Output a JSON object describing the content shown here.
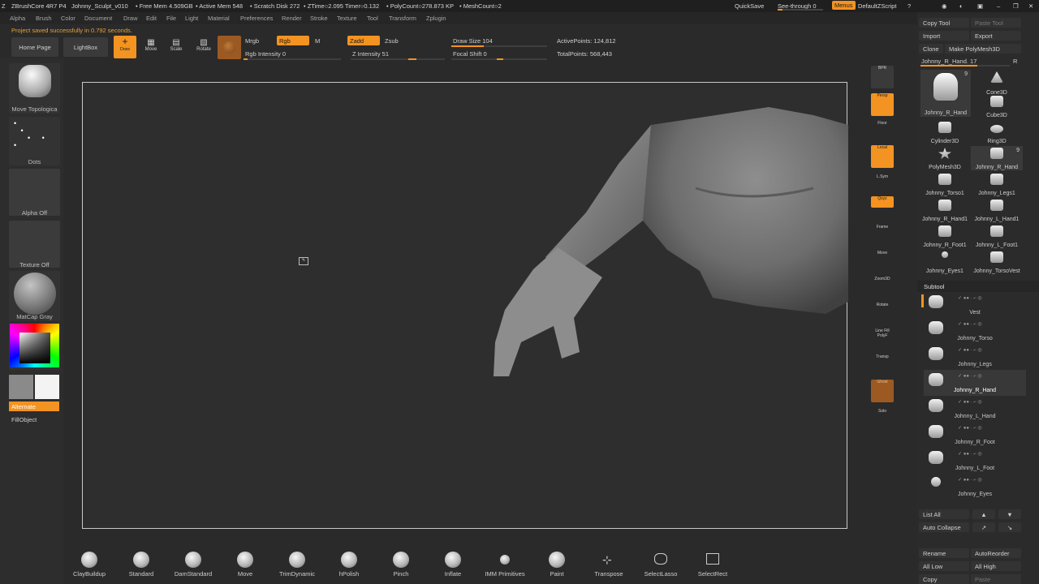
{
  "titlebar": {
    "app": "ZBrushCore 4R7 P4",
    "doc": "Johnny_Sculpt_v010",
    "free_mem": "• Free Mem 4.509GB",
    "active_mem": "• Active Mem 548",
    "scratch": "• Scratch Disk 272",
    "ztime": "• ZTime○2.095 Timer○0.132",
    "polycount": "• PolyCount○278.873 KP",
    "meshcount": "• MeshCount○2",
    "quicksave": "QuickSave",
    "seethrough": "See-through  0",
    "menus": "Menus",
    "zscript": "DefaultZScript"
  },
  "menubar": [
    "Alpha",
    "Brush",
    "Color",
    "Document",
    "Draw",
    "Edit",
    "File",
    "Light",
    "Material",
    "Preferences",
    "Render",
    "Stroke",
    "Texture",
    "Tool",
    "Transform",
    "Zplugin"
  ],
  "status": "Project saved successfully in 0.792 seconds.",
  "toolbar": {
    "home": "Home Page",
    "lightbox": "LightBox",
    "draw": "Draw",
    "move": "Move",
    "scale": "Scale",
    "rotate": "Rotate",
    "mrgb": "Mrgb",
    "rgb": "Rgb",
    "m": "M",
    "rgb_intensity": "Rgb Intensity 0",
    "zadd": "Zadd",
    "zsub": "Zsub",
    "z_intensity": "Z Intensity 51",
    "z_intensity_value": 0.51,
    "draw_size": "Draw Size 104",
    "focal_shift": "Focal Shift 0",
    "active_points": "ActivePoints: 124,812",
    "total_points": "TotalPoints: 568,443"
  },
  "left": {
    "brush": "Move Topologica",
    "stroke": "Dots",
    "alpha": "Alpha Off",
    "texture": "Texture Off",
    "material": "MatCap Gray",
    "alternate": "Alternate",
    "fillobject": "FillObject"
  },
  "right_shelf": [
    "BPR",
    "Persp",
    "Floor",
    "Local",
    "L.Sym",
    "Qxyz",
    "Frame",
    "Move",
    "Zoom3D",
    "Rotate",
    "Line Fill PolyF",
    "Transp",
    "Ghost",
    "Solo"
  ],
  "tool_panel": {
    "copy_tool": "Copy Tool",
    "paste_tool": "Paste Tool",
    "import": "Import",
    "export": "Export",
    "clone": "Clone",
    "make_polymesh": "Make PolyMesh3D",
    "current": "Johnny_R_Hand. 17",
    "r": "R",
    "tools": [
      {
        "label": "Johnny_R_Hand",
        "badge": "9"
      },
      {
        "label": "Cone3D",
        "badge": ""
      },
      {
        "label": "Cube3D",
        "badge": ""
      },
      {
        "label": "Cylinder3D",
        "badge": ""
      },
      {
        "label": "Ring3D",
        "badge": ""
      },
      {
        "label": "PolyMesh3D",
        "badge": ""
      },
      {
        "label": "Johnny_R_Hand",
        "badge": "9"
      },
      {
        "label": "Johnny_Torso1",
        "badge": ""
      },
      {
        "label": "Johnny_Legs1",
        "badge": ""
      },
      {
        "label": "Johnny_R_Hand1",
        "badge": ""
      },
      {
        "label": "Johnny_L_Hand1",
        "badge": ""
      },
      {
        "label": "Johnny_R_Foot1",
        "badge": ""
      },
      {
        "label": "Johnny_L_Foot1",
        "badge": ""
      },
      {
        "label": "Johnny_Eyes1",
        "badge": ""
      },
      {
        "label": "Johnny_TorsoVest",
        "badge": ""
      }
    ],
    "subtool": "Subtool",
    "subtools": [
      "Vest",
      "Johnny_Torso",
      "Johnny_Legs",
      "Johnny_R_Hand",
      "Johnny_L_Hand",
      "Johnny_R_Foot",
      "Johnny_L_Foot",
      "Johnny_Eyes"
    ],
    "list_all": "List All",
    "auto_collapse": "Auto Collapse",
    "rename": "Rename",
    "autoreorder": "AutoReorder",
    "all_low": "All Low",
    "all_high": "All High",
    "copy": "Copy",
    "paste": "Paste"
  },
  "brushes": [
    "ClayBuildup",
    "Standard",
    "DamStandard",
    "Move",
    "TrimDynamic",
    "hPolish",
    "Pinch",
    "Inflate",
    "IMM Primitives",
    "Paint",
    "Transpose",
    "SelectLasso",
    "SelectRect"
  ],
  "colors": {
    "accent": "#f39322",
    "bg": "#2a2a2a"
  }
}
